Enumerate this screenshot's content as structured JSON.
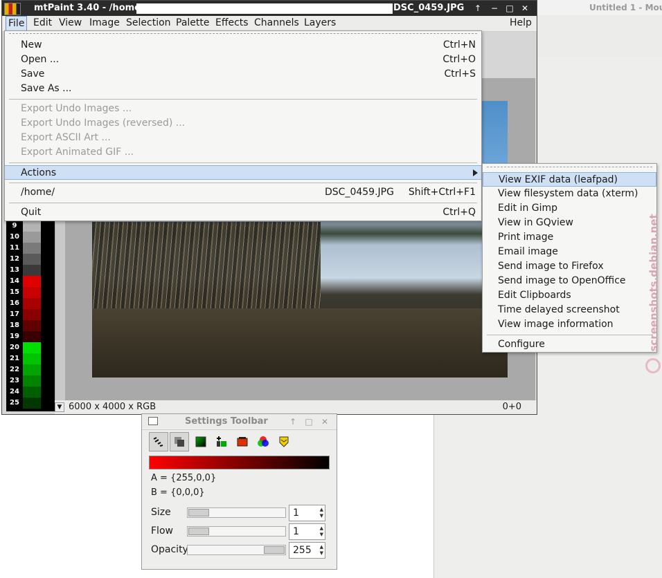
{
  "background_window": {
    "title": "Untitled 1 - Mou"
  },
  "main_window": {
    "title_prefix": "mtPaint 3.40 - /home/",
    "title_file": "DSC_0459.JPG",
    "buttons": {
      "up": "↑",
      "minimize": "−",
      "maximize": "□",
      "close": "✕"
    }
  },
  "menubar": {
    "file": "File",
    "edit": "Edit",
    "view": "View",
    "image": "Image",
    "selection": "Selection",
    "palette": "Palette",
    "effects": "Effects",
    "channels": "Channels",
    "layers": "Layers",
    "help": "Help"
  },
  "file_menu": {
    "new": {
      "label": "New",
      "accel": "Ctrl+N"
    },
    "open": {
      "label": "Open ...",
      "accel": "Ctrl+O"
    },
    "save": {
      "label": "Save",
      "accel": "Ctrl+S"
    },
    "save_as": {
      "label": "Save As ..."
    },
    "export_undo": {
      "label": "Export Undo Images ..."
    },
    "export_undo_rev": {
      "label": "Export Undo Images (reversed) ..."
    },
    "export_ascii": {
      "label": "Export ASCII Art ..."
    },
    "export_gif": {
      "label": "Export Animated GIF ..."
    },
    "actions": {
      "label": "Actions"
    },
    "recent": {
      "label": "/home/",
      "file": "DSC_0459.JPG",
      "accel": "Shift+Ctrl+F1"
    },
    "quit": {
      "label": "Quit",
      "accel": "Ctrl+Q"
    }
  },
  "actions_menu": [
    "View EXIF data (leafpad)",
    "View filesystem data (xterm)",
    "Edit in Gimp",
    "View in GQview",
    "Print image",
    "Email image",
    "Send image to Firefox",
    "Send image to OpenOffice",
    "Edit Clipboards",
    "Time delayed screenshot",
    "View image information",
    "Configure"
  ],
  "palette_rows": [
    {
      "n": "9",
      "color": "#b4b4b4"
    },
    {
      "n": "10",
      "color": "#9a9a9a"
    },
    {
      "n": "11",
      "color": "#7a7a7a"
    },
    {
      "n": "12",
      "color": "#5a5a5a"
    },
    {
      "n": "13",
      "color": "#3a3a3a"
    },
    {
      "n": "14",
      "color": "#e00000"
    },
    {
      "n": "15",
      "color": "#c80000"
    },
    {
      "n": "16",
      "color": "#a80000"
    },
    {
      "n": "17",
      "color": "#880000"
    },
    {
      "n": "18",
      "color": "#600000"
    },
    {
      "n": "19",
      "color": "#380000"
    },
    {
      "n": "20",
      "color": "#00e000"
    },
    {
      "n": "21",
      "color": "#00c400"
    },
    {
      "n": "22",
      "color": "#00a400"
    },
    {
      "n": "23",
      "color": "#008400"
    },
    {
      "n": "24",
      "color": "#006000"
    },
    {
      "n": "25",
      "color": "#003800"
    }
  ],
  "status": {
    "dimensions": "6000 x 4000 x RGB",
    "coords": "0+0"
  },
  "settings": {
    "title": "Settings Toolbar",
    "color_a": "A = {255,0,0}",
    "color_b": "B = {0,0,0}",
    "size": {
      "label": "Size",
      "value": "1",
      "level": 0.0
    },
    "flow": {
      "label": "Flow",
      "value": "1",
      "level": 0.0
    },
    "opacity": {
      "label": "Opacity",
      "value": "255",
      "level": 1.0
    }
  },
  "watermark": "screenshots.debian.net"
}
